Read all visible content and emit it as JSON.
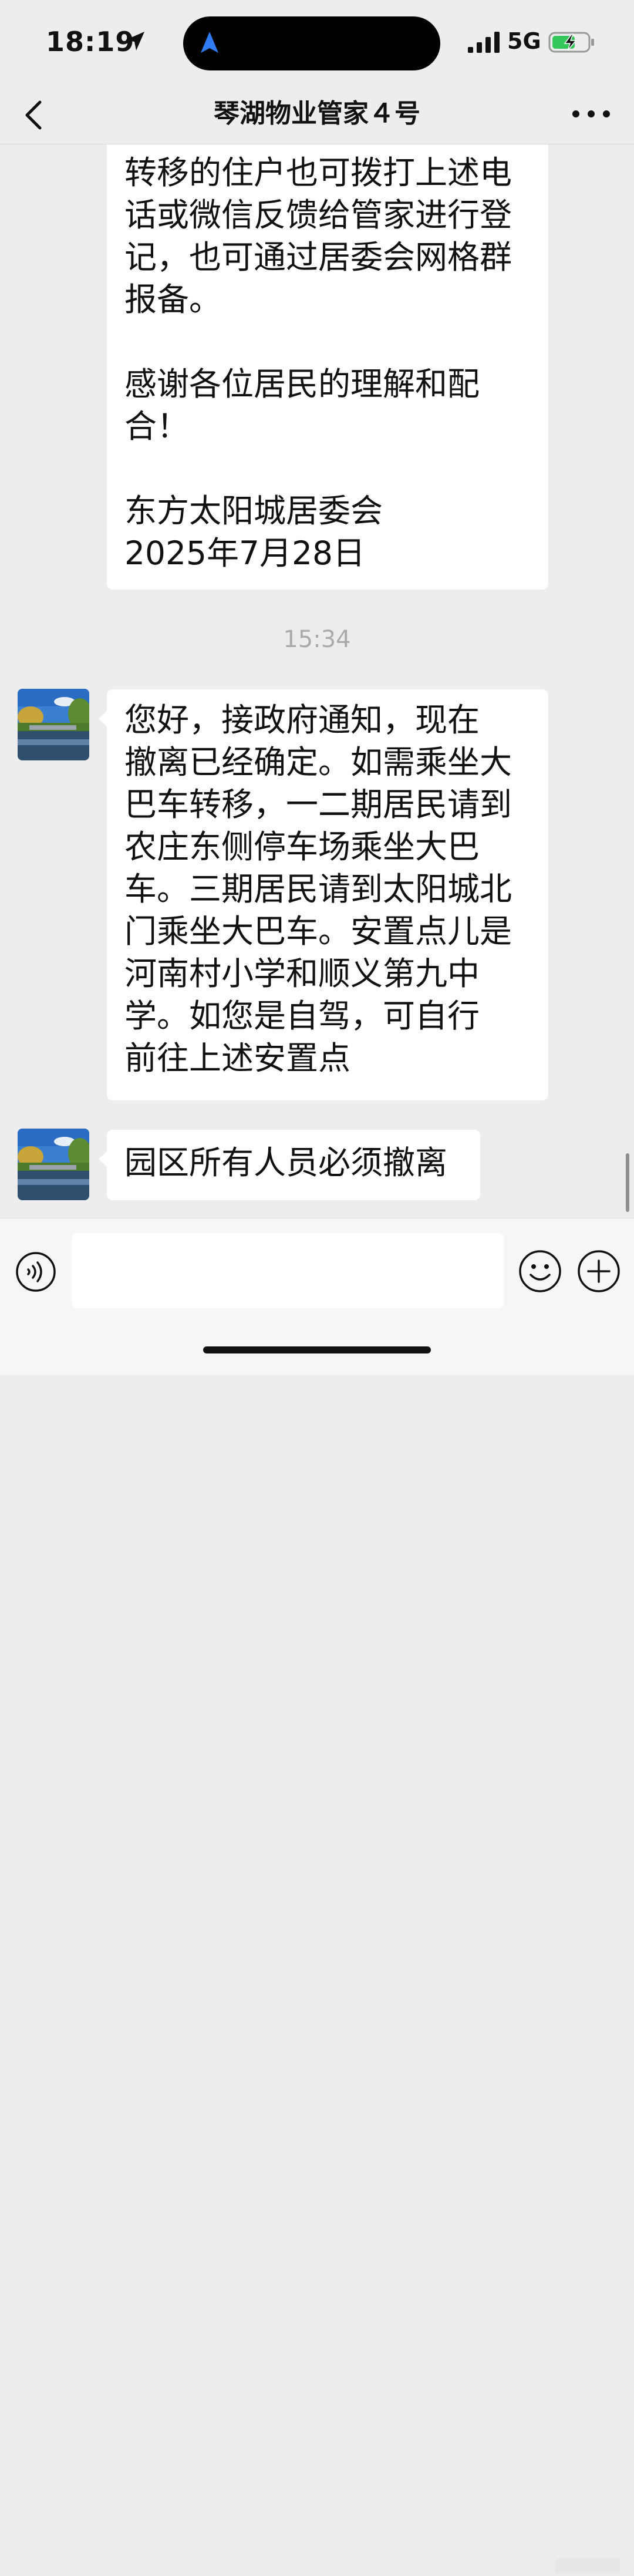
{
  "status_bar": {
    "time": "18:19",
    "network": "5G"
  },
  "header": {
    "title": "琴湖物业管家４号"
  },
  "messages": [
    {
      "paragraphs": [
        "转移的住户也可拨打上述电\n话或微信反馈给管家进行登\n记，也可通过居委会网格群\n报备。",
        "感谢各位居民的理解和配\n合！",
        "东方太阳城居委会\n2025年7月28日"
      ]
    },
    {
      "timestamp": "15:34"
    },
    {
      "text": "您好，接政府通知，现在\n撤离已经确定。如需乘坐大\n巴车转移，一二期居民请到\n农庄东侧停车场乘坐大巴\n车。三期居民请到太阳城北\n门乘坐大巴车。安置点儿是\n河南村小学和顺义第九中\n学。如您是自驾，可自行\n前往上述安置点"
    },
    {
      "text": "园区所有人员必须撤离"
    }
  ],
  "input": {
    "value": "",
    "placeholder": ""
  },
  "icons": [
    "location-arrow-icon",
    "signal-icon",
    "battery-charging-icon",
    "back-chevron-icon",
    "more-dots-icon",
    "voice-icon",
    "emoji-icon",
    "plus-icon"
  ]
}
